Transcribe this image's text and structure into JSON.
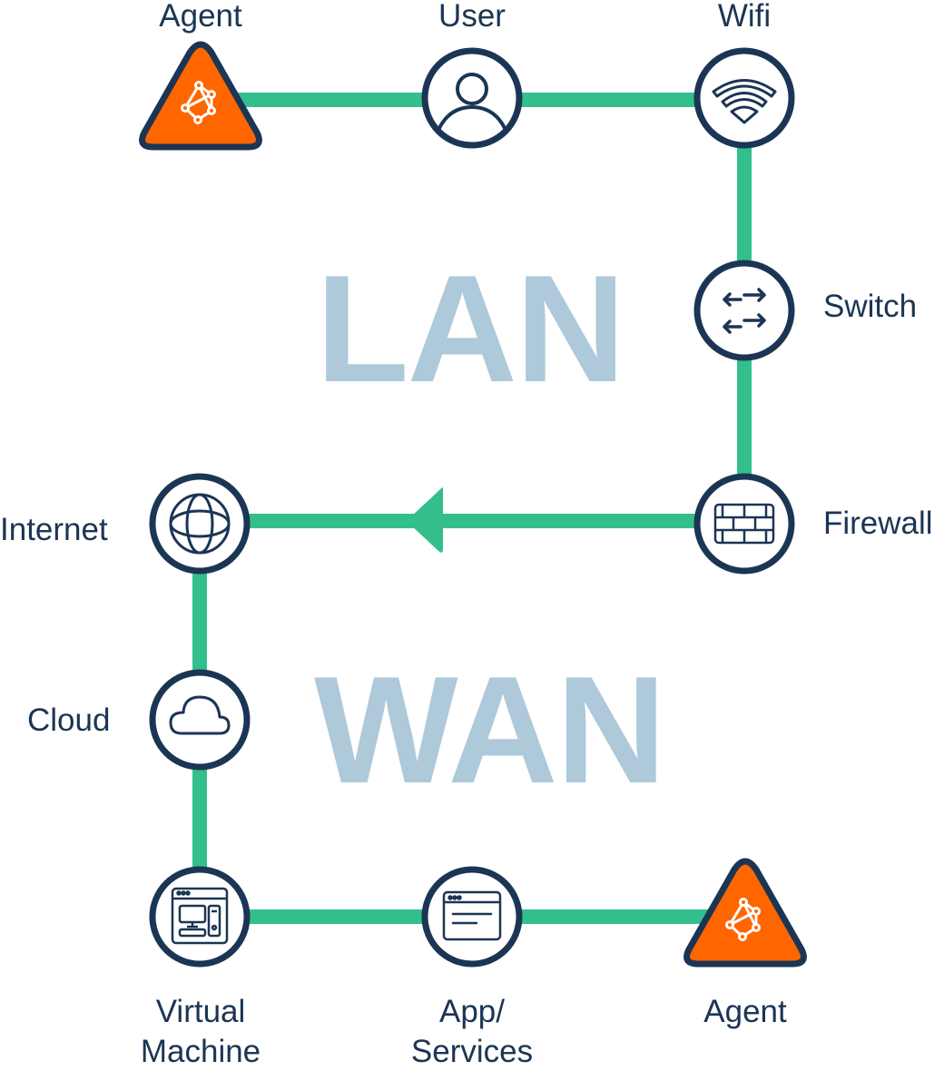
{
  "colors": {
    "line": "#33bf8c",
    "node_stroke": "#1b3554",
    "agent_fill": "#ff6600",
    "zone_text": "#adc9da",
    "label_text": "#1b3554"
  },
  "zones": {
    "lan": "LAN",
    "wan": "WAN"
  },
  "nodes": {
    "agent_top": {
      "label": "Agent",
      "icon": "agent-network-icon"
    },
    "user": {
      "label": "User",
      "icon": "user-icon"
    },
    "wifi": {
      "label": "Wifi",
      "icon": "wifi-icon"
    },
    "switch": {
      "label": "Switch",
      "icon": "switch-arrows-icon"
    },
    "firewall": {
      "label": "Firewall",
      "icon": "firewall-brick-icon"
    },
    "internet": {
      "label": "Internet",
      "icon": "globe-icon"
    },
    "cloud": {
      "label": "Cloud",
      "icon": "cloud-icon"
    },
    "vm": {
      "label_line1": "Virtual",
      "label_line2": "Machine",
      "icon": "virtual-machine-icon"
    },
    "app": {
      "label_line1": "App/",
      "label_line2": "Services",
      "icon": "app-window-icon"
    },
    "agent_bottom": {
      "label": "Agent",
      "icon": "agent-network-icon"
    }
  },
  "flow": {
    "direction": "Firewall to Internet"
  }
}
